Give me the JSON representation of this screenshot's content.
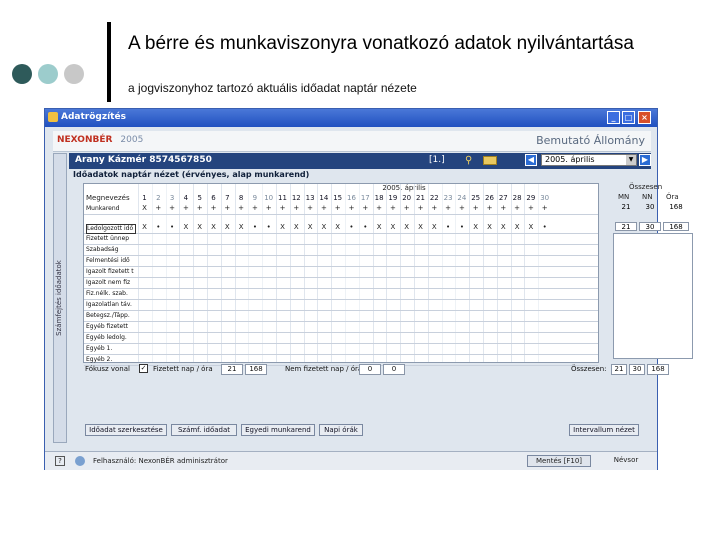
{
  "slide": {
    "title": "A bérre és munkaviszonyra vonatkozó adatok nyilvántartása",
    "subtitle": "a jogviszonyhoz tartozó aktuális időadat naptár nézete",
    "dot_colors": [
      "#2e5a5a",
      "#9ccccc",
      "#c8c8c8"
    ]
  },
  "window": {
    "title": "Adatrögzítés",
    "brand": "NEXONBÉR",
    "brand_year": "2005",
    "brand_right": "Bemutató Állomány",
    "employee": "Arany Kázmér 8574567850",
    "page_indicator": "[1.]",
    "period_selected": "2005. április",
    "subheading": "Időadatok naptár nézet (érvényes, alap munkarend)",
    "sidebar_label": "Számfejtés időadatok",
    "month_label": "2005. április",
    "name_col_header": "Megnevezés",
    "days": [
      "1",
      "2",
      "3",
      "4",
      "5",
      "6",
      "7",
      "8",
      "9",
      "10",
      "11",
      "12",
      "13",
      "14",
      "15",
      "16",
      "17",
      "18",
      "19",
      "20",
      "21",
      "22",
      "23",
      "24",
      "25",
      "26",
      "27",
      "28",
      "29",
      "30"
    ],
    "weekend_days": [
      "2",
      "3",
      "9",
      "10",
      "16",
      "17",
      "23",
      "24",
      "30"
    ],
    "rows": [
      {
        "label": "Munkarend",
        "cells": [
          "X",
          "+",
          "+",
          "+",
          "+",
          "+",
          "+",
          "+",
          "+",
          "+",
          "+",
          "+",
          "+",
          "+",
          "+",
          "+",
          "+",
          "+",
          "+",
          "+",
          "+",
          "+",
          "+",
          "+",
          "+",
          "+",
          "+",
          "+",
          "+",
          "+"
        ]
      },
      {
        "label": "Ledolgozott idő",
        "cells": [
          "X",
          "•",
          "•",
          "X",
          "X",
          "X",
          "X",
          "X",
          "•",
          "•",
          "X",
          "X",
          "X",
          "X",
          "X",
          "•",
          "•",
          "X",
          "X",
          "X",
          "X",
          "X",
          "•",
          "•",
          "X",
          "X",
          "X",
          "X",
          "X",
          "•"
        ]
      },
      {
        "label": "Fizetett ünnep",
        "cells": []
      },
      {
        "label": "Szabadság",
        "cells": []
      },
      {
        "label": "Felmentési idő",
        "cells": []
      },
      {
        "label": "Igazolt fizetett t",
        "cells": []
      },
      {
        "label": "Igazolt nem fiz",
        "cells": []
      },
      {
        "label": "Fiz.nélk. szab.",
        "cells": []
      },
      {
        "label": "Igazolatlan táv.",
        "cells": []
      },
      {
        "label": "Betegsz./Tápp.",
        "cells": []
      },
      {
        "label": "Egyéb fizetett",
        "cells": []
      },
      {
        "label": "Egyéb ledolg.",
        "cells": []
      },
      {
        "label": "Egyéb 1.",
        "cells": []
      },
      {
        "label": "Egyéb 2.",
        "cells": []
      }
    ],
    "summary": {
      "header": "Összesen",
      "cols": [
        "MN",
        "NN",
        "Óra"
      ],
      "row1": [
        "21",
        "30",
        "168"
      ],
      "row2": [
        "21",
        "30",
        "168"
      ]
    },
    "footer": {
      "focus_label": "Fókusz vonal",
      "paid_label": "Fizetett nap / óra",
      "paid_day": "21",
      "paid_hour": "168",
      "unpaid_label": "Nem fizetett nap / óra",
      "unpaid_day": "0",
      "unpaid_hour": "0",
      "total_label": "Összesen:",
      "total_mn": "21",
      "total_nn": "30",
      "total_ora": "168"
    },
    "buttons": [
      "Időadat szerkesztése",
      "Számf. időadat",
      "Egyedi munkarend",
      "Napi órák",
      "Intervallum nézet"
    ],
    "status_user": "Felhasználó: NexonBÉR adminisztrátor",
    "status_save": "Mentés [F10]",
    "status_close": "Névsor"
  }
}
